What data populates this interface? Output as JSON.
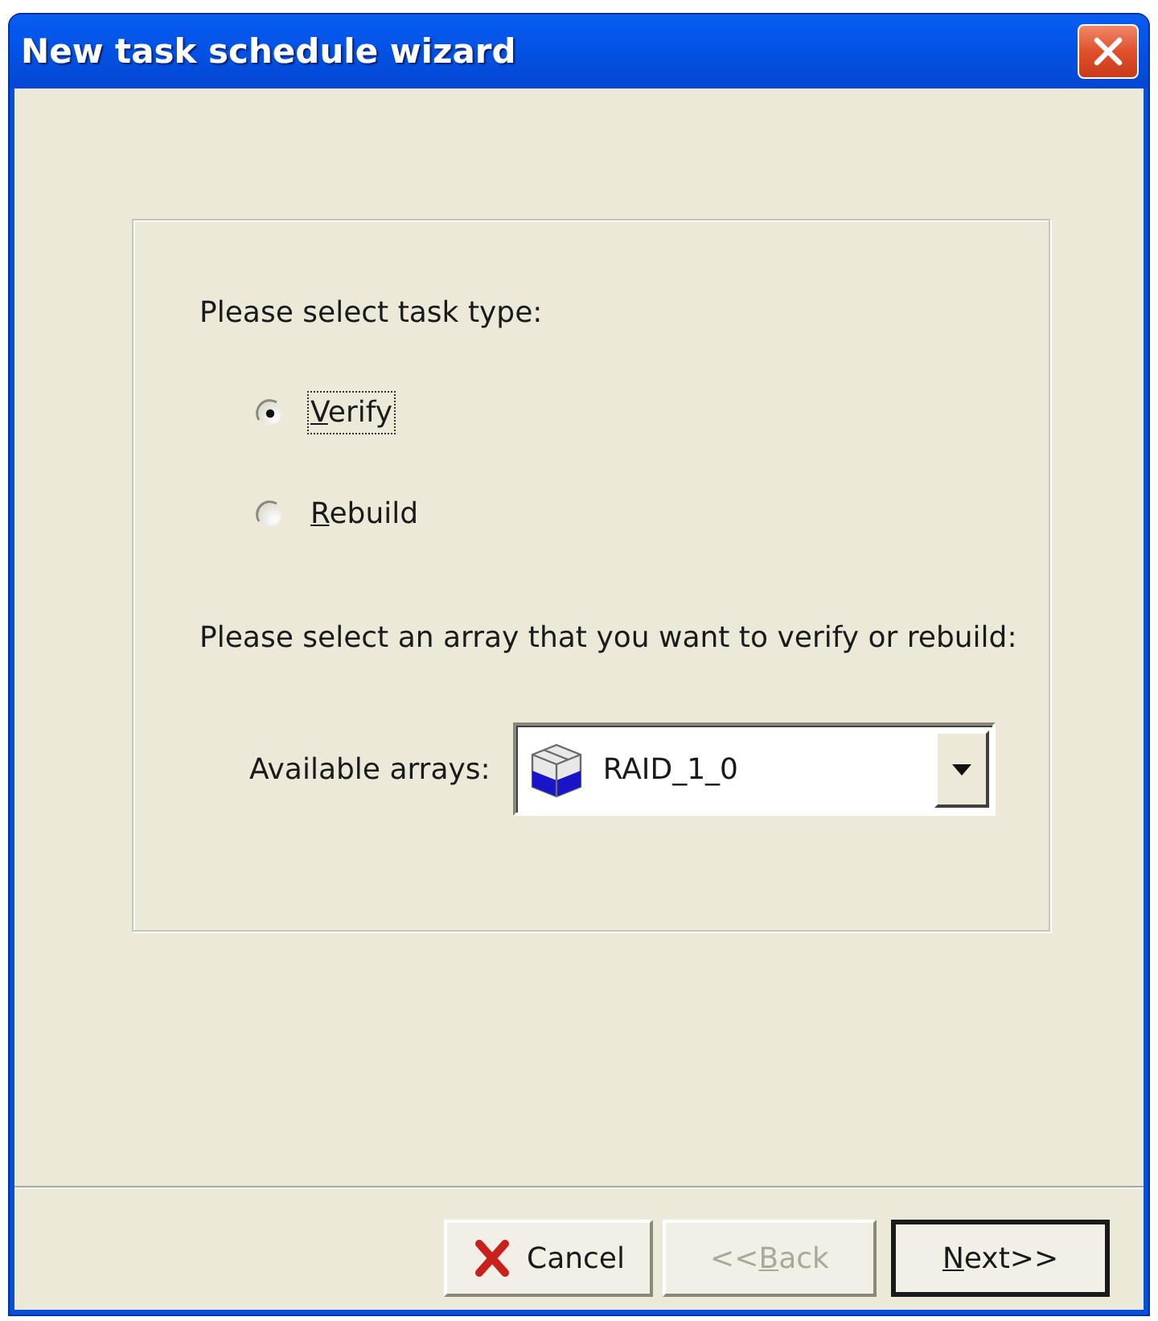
{
  "window": {
    "title": "New task schedule wizard"
  },
  "task_type": {
    "prompt": "Please select task type:",
    "options": [
      {
        "label": "Verify",
        "mnemonic_underlined": true,
        "selected": true,
        "focused": true
      },
      {
        "label": "Rebuild",
        "mnemonic_underlined": true,
        "selected": false,
        "focused": false
      }
    ]
  },
  "array": {
    "prompt": "Please select an array that you want to verify or rebuild:",
    "field_label": "Available arrays:",
    "value": "RAID_1_0"
  },
  "buttons": [
    {
      "kind": "cancel",
      "label": "Cancel",
      "mnemonic_underlined": false,
      "disabled": false,
      "default": false
    },
    {
      "kind": "back",
      "label": "<<Back",
      "mnemonic_underlined": true,
      "disabled": true,
      "default": false
    },
    {
      "kind": "next",
      "label": "Next>>",
      "mnemonic_underlined": true,
      "disabled": false,
      "default": true
    }
  ]
}
